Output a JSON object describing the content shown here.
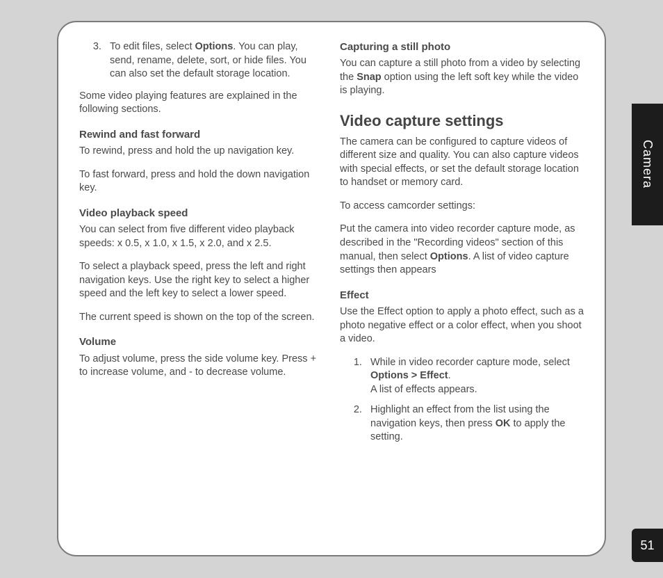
{
  "sideTab": "Camera",
  "pageNumber": "51",
  "left": {
    "item3_pre": "To edit files, select ",
    "item3_bold": "Options",
    "item3_post": ". You can play, send, rename, delete, sort, or hide files. You can also set the default storage location.",
    "intro": "Some video playing features are explained in the following sections.",
    "rewind_h": "Rewind and fast forward",
    "rewind_p1": "To rewind, press and hold the up navigation key.",
    "rewind_p2": "To fast forward, press and hold the down navigation key.",
    "speed_h": "Video playback speed",
    "speed_p1": "You can select from five different video playback speeds: x 0.5, x 1.0, x 1.5, x 2.0, and x 2.5.",
    "speed_p2": "To select a playback speed, press the left and right navigation keys. Use the right key to select a higher speed and the left key to select a lower speed.",
    "speed_p3": "The current speed is shown on the top of the screen.",
    "volume_h": "Volume",
    "volume_p": "To adjust volume, press the side volume key. Press + to increase volume, and - to decrease volume."
  },
  "right": {
    "still_h": "Capturing a still photo",
    "still_pre": "You can capture a still photo from a video by selecting the ",
    "still_bold": "Snap",
    "still_post": " option using the left soft key while the video is playing.",
    "vcs_h": "Video capture settings",
    "vcs_p1": "The camera can be configured to capture videos of different size and quality. You can also capture videos with special effects, or set the default storage location to handset or memory card.",
    "vcs_p2": "To access camcorder settings:",
    "vcs_p3_pre": "Put the camera into video recorder capture mode, as described in the \"Recording videos\" section of this manual, then select ",
    "vcs_p3_bold": "Options",
    "vcs_p3_post": ". A list of video capture settings then appears",
    "effect_h": "Effect",
    "effect_p": "Use the Effect option to apply a photo effect, such as a photo negative effect or a color effect, when you shoot a video.",
    "eff1_pre": "While in video recorder capture mode, select ",
    "eff1_bold": "Options > Effect",
    "eff1_post": ".",
    "eff1_line2": "A list of effects appears.",
    "eff2_pre": "Highlight an effect from the list using the navigation keys, then press ",
    "eff2_bold": "OK",
    "eff2_post": " to apply the setting."
  }
}
